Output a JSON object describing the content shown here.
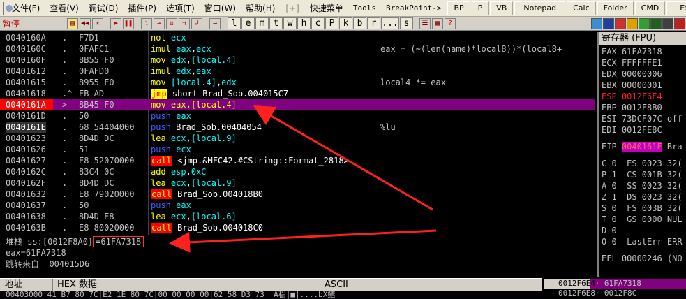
{
  "menu": {
    "items": [
      "文件(F)",
      "查看(V)",
      "调试(D)",
      "插件(P)",
      "选项(T)",
      "窗口(W)",
      "帮助(H)"
    ],
    "plus": "[+]",
    "quick_menu": "快捷菜单",
    "tools": "Tools",
    "breakpoint": "BreakPoint->",
    "right_buttons": [
      "BP",
      "P",
      "VB",
      "Notepad",
      "Calc",
      "Folder",
      "CMD",
      "Exit"
    ]
  },
  "toolbar": {
    "status": "暂停",
    "letters": [
      "l",
      "e",
      "m",
      "t",
      "w",
      "h",
      "c",
      "P",
      "k",
      "b",
      "r",
      "...",
      "s"
    ]
  },
  "disasm": {
    "rows": [
      {
        "addr": "0040160A",
        "mark": ".",
        "hex": "F7D1",
        "asm": [
          [
            "yellow",
            "not "
          ],
          [
            "cyan",
            "ecx"
          ]
        ],
        "cmt": ""
      },
      {
        "addr": "0040160C",
        "mark": ".",
        "hex": "0FAFC1",
        "asm": [
          [
            "yellow",
            "imul "
          ],
          [
            "cyan",
            "eax"
          ],
          [
            "white",
            ","
          ],
          [
            "cyan",
            "ecx"
          ]
        ],
        "cmt": "eax = (~(len(name)*local8))*(local8+"
      },
      {
        "addr": "0040160F",
        "mark": ".",
        "hex": "8B55 F0",
        "asm": [
          [
            "yellow",
            "mov "
          ],
          [
            "cyan",
            "edx"
          ],
          [
            "white",
            ","
          ],
          [
            "cyan",
            "[local.4]"
          ]
        ],
        "cmt": ""
      },
      {
        "addr": "00401612",
        "mark": ".",
        "hex": "0FAFD0",
        "asm": [
          [
            "yellow",
            "imul "
          ],
          [
            "cyan",
            "edx"
          ],
          [
            "white",
            ","
          ],
          [
            "cyan",
            "eax"
          ]
        ],
        "cmt": ""
      },
      {
        "addr": "00401615",
        "mark": ".",
        "hex": "8955 F0",
        "asm": [
          [
            "yellow",
            "mov "
          ],
          [
            "cyan",
            "[local.4]"
          ],
          [
            "white",
            ","
          ],
          [
            "cyan",
            "edx"
          ]
        ],
        "cmt": "local4 *= eax"
      },
      {
        "addr": "00401618",
        "mark": ".^",
        "hex": "EB AD",
        "asm": [
          [
            "jmp",
            "jmp"
          ],
          [
            "white",
            " short Brad_Sob.004015C7"
          ]
        ],
        "cmt": ""
      },
      {
        "addr": "0040161A",
        "mark": ">",
        "hex": "8B45 F0",
        "asm": [
          [
            "yellow",
            "mov "
          ],
          [
            "yellow",
            "eax"
          ],
          [
            "yellow",
            ","
          ],
          [
            "yellow",
            "[local.4]"
          ]
        ],
        "cmt": "",
        "selected": true
      },
      {
        "addr": "0040161D",
        "mark": ".",
        "hex": "50",
        "asm": [
          [
            "blue",
            "push "
          ],
          [
            "cyan",
            "eax"
          ]
        ],
        "cmt": ""
      },
      {
        "addr": "0040161E",
        "mark": ".",
        "hex": "68 54404000",
        "asm": [
          [
            "blue",
            "push "
          ],
          [
            "white",
            "Brad_Sob.00404054"
          ]
        ],
        "cmt": "%lu",
        "current": true
      },
      {
        "addr": "00401623",
        "mark": ".",
        "hex": "8D4D DC",
        "asm": [
          [
            "yellow",
            "lea "
          ],
          [
            "cyan",
            "ecx"
          ],
          [
            "white",
            ","
          ],
          [
            "cyan",
            "[local.9]"
          ]
        ],
        "cmt": ""
      },
      {
        "addr": "00401626",
        "mark": ".",
        "hex": "51",
        "asm": [
          [
            "blue",
            "push "
          ],
          [
            "cyan",
            "ecx"
          ]
        ],
        "cmt": ""
      },
      {
        "addr": "00401627",
        "mark": ".",
        "hex": "E8 52070000",
        "asm": [
          [
            "call",
            "call"
          ],
          [
            "white",
            " <jmp.&MFC42.#CString::Format_2818>"
          ]
        ],
        "cmt": ""
      },
      {
        "addr": "0040162C",
        "mark": ".",
        "hex": "83C4 0C",
        "asm": [
          [
            "yellow",
            "add "
          ],
          [
            "cyan",
            "esp"
          ],
          [
            "white",
            ","
          ],
          [
            "cyan",
            "0xC"
          ]
        ],
        "cmt": ""
      },
      {
        "addr": "0040162F",
        "mark": ".",
        "hex": "8D4D DC",
        "asm": [
          [
            "yellow",
            "lea "
          ],
          [
            "cyan",
            "ecx"
          ],
          [
            "white",
            ","
          ],
          [
            "cyan",
            "[local.9]"
          ]
        ],
        "cmt": ""
      },
      {
        "addr": "00401632",
        "mark": ".",
        "hex": "E8 79020000",
        "asm": [
          [
            "call",
            "call"
          ],
          [
            "white",
            " Brad_Sob.004018B0"
          ]
        ],
        "cmt": ""
      },
      {
        "addr": "00401637",
        "mark": ".",
        "hex": "50",
        "asm": [
          [
            "blue",
            "push "
          ],
          [
            "cyan",
            "eax"
          ]
        ],
        "cmt": ""
      },
      {
        "addr": "00401638",
        "mark": ".",
        "hex": "8D4D E8",
        "asm": [
          [
            "yellow",
            "lea "
          ],
          [
            "cyan",
            "ecx"
          ],
          [
            "white",
            ","
          ],
          [
            "cyan",
            "[local.6]"
          ]
        ],
        "cmt": ""
      },
      {
        "addr": "0040163B",
        "mark": ".",
        "hex": "E8 80020000",
        "asm": [
          [
            "call",
            "call"
          ],
          [
            "white",
            " Brad_Sob.004018C0"
          ]
        ],
        "cmt": ""
      }
    ]
  },
  "info": {
    "stack_prefix": "堆栈 ss:[0012F8A0]",
    "stack_value": "=61FA7318",
    "eax_line": "eax=61FA7318",
    "jump_from": "跳转来自  004015D6"
  },
  "registers": {
    "title": "寄存器 (FPU)",
    "lines": [
      {
        "t": "EAX 61FA7318",
        "red": false
      },
      {
        "t": "ECX FFFFFFE1",
        "red": false
      },
      {
        "t": "EDX 00000006",
        "red": false
      },
      {
        "t": "EBX 00000001",
        "red": false
      },
      {
        "t": "ESP 0012F6E4",
        "red": true
      },
      {
        "t": "EBP 0012F8B0",
        "red": false
      },
      {
        "t": "ESI 73DCF07C off",
        "red": false
      },
      {
        "t": "EDI 0012FE8C",
        "red": false
      }
    ],
    "eip_label": "EIP ",
    "eip_value": "0040161E",
    "eip_suffix": " Bra",
    "flags": [
      "C 0  ES 0023 32(",
      "P 1  CS 001B 32(",
      "A 0  SS 0023 32(",
      "Z 1  DS 0023 32(",
      "S 0  FS 003B 32(",
      "T 0  GS 0000 NUL",
      "D 0",
      "O 0  LastErr ERR"
    ],
    "efl": "EFL 00000246 (NO"
  },
  "dump": {
    "headers": [
      "地址",
      "HEX 数据",
      "ASCII"
    ],
    "row": "00403000 41 B7 80 7C|E2 1E 80 7C|00 00 00 00|62 58 D3 73  A稆|■|....bX鳝"
  },
  "stack": {
    "rows": [
      {
        "addr": "0012F6E4",
        "val": "61FA7318",
        "sel": true
      },
      {
        "addr": "0012F6E8",
        "val": "0012F8C",
        "sel": false
      }
    ]
  }
}
